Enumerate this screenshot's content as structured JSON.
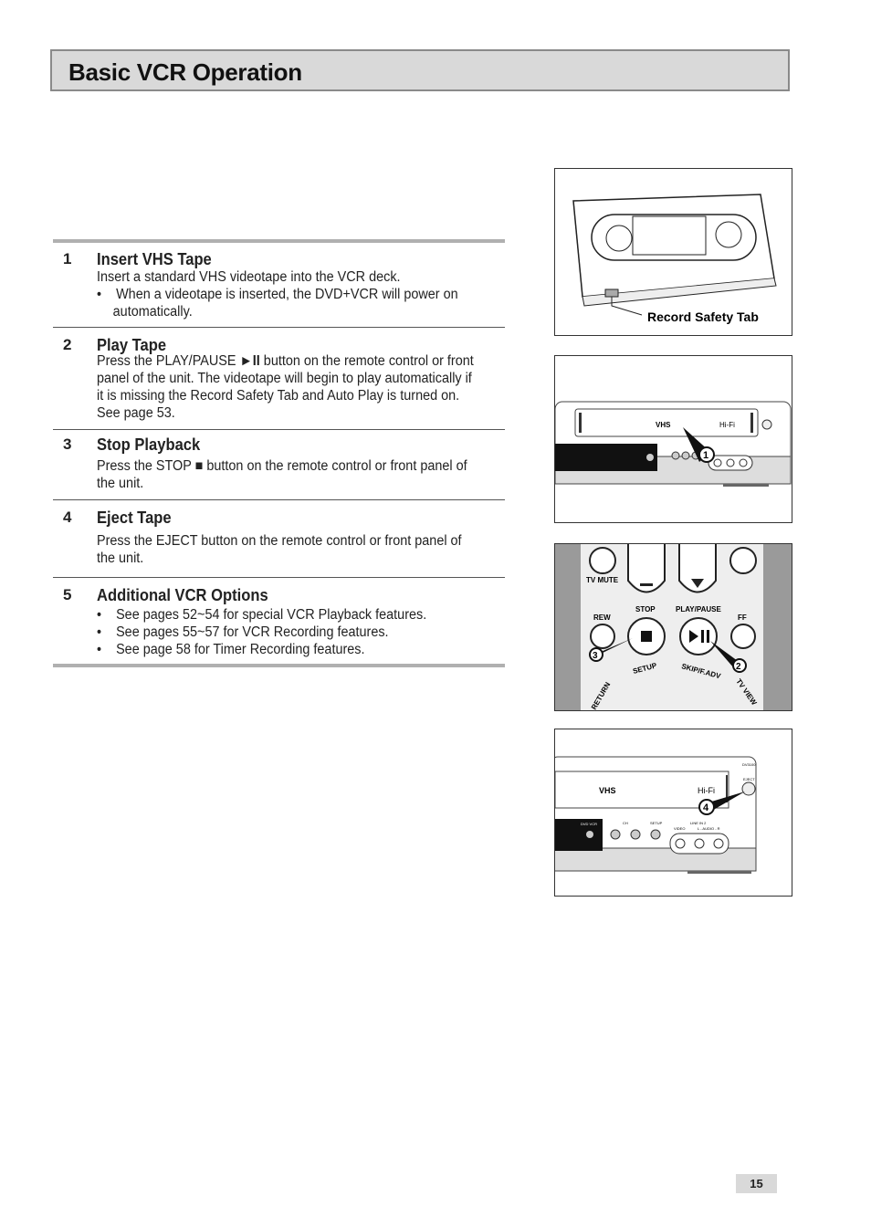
{
  "title": "Basic VCR Operation",
  "steps": [
    {
      "num": "1",
      "heading": "Insert VHS Tape",
      "lines": [
        "Insert a standard VHS videotape into the VCR deck."
      ],
      "bullets": [
        "When a videotape is inserted, the DVD+VCR will power on automatically."
      ]
    },
    {
      "num": "2",
      "heading": "Play Tape",
      "text_before": "Press the PLAY/PAUSE ",
      "symbol": "►II",
      "text_after": " button on the remote control or front panel of the unit. The videotape will begin to play automatically if it is missing the Record Safety Tab and Auto Play is turned on. See page 53."
    },
    {
      "num": "3",
      "heading": "Stop Playback",
      "text_before": "Press the STOP ",
      "symbol": "■",
      "text_after": "  button on the remote control or front panel of the unit."
    },
    {
      "num": "4",
      "heading": "Eject Tape",
      "lines": [
        "Press the EJECT button on the remote control or front panel of the unit."
      ]
    },
    {
      "num": "5",
      "heading": "Additional VCR Options",
      "bullets": [
        "See pages 52~54 for special VCR Playback features.",
        "See pages 55~57 for VCR Recording features.",
        "See page 58 for Timer Recording features."
      ]
    }
  ],
  "figures": {
    "tape": {
      "label": "Record Safety Tab"
    },
    "front1": {
      "callout": "1",
      "vhs": "VHS",
      "hifi": "Hi-Fi"
    },
    "remote": {
      "tv_mute": "TV MUTE",
      "stop": "STOP",
      "play_pause": "PLAY/PAUSE",
      "rew": "REW",
      "ff": "FF",
      "setup": "SETUP",
      "skip": "SKIP/F.ADV",
      "return": "RETURN",
      "tv_view": "TV VIEW",
      "callout_stop": "3",
      "callout_play": "2"
    },
    "front2": {
      "callout": "4",
      "vhs": "VHS",
      "hifi": "Hi-Fi",
      "eject": "EJECT",
      "model": "DV3100",
      "dvd_vcr": "DVD VCR",
      "ch": "CH",
      "setup": "SETUP",
      "line_in": "LINE IN 2",
      "video": "VIDEO",
      "audio": "L - AUDIO - R"
    }
  },
  "page_number": "15"
}
